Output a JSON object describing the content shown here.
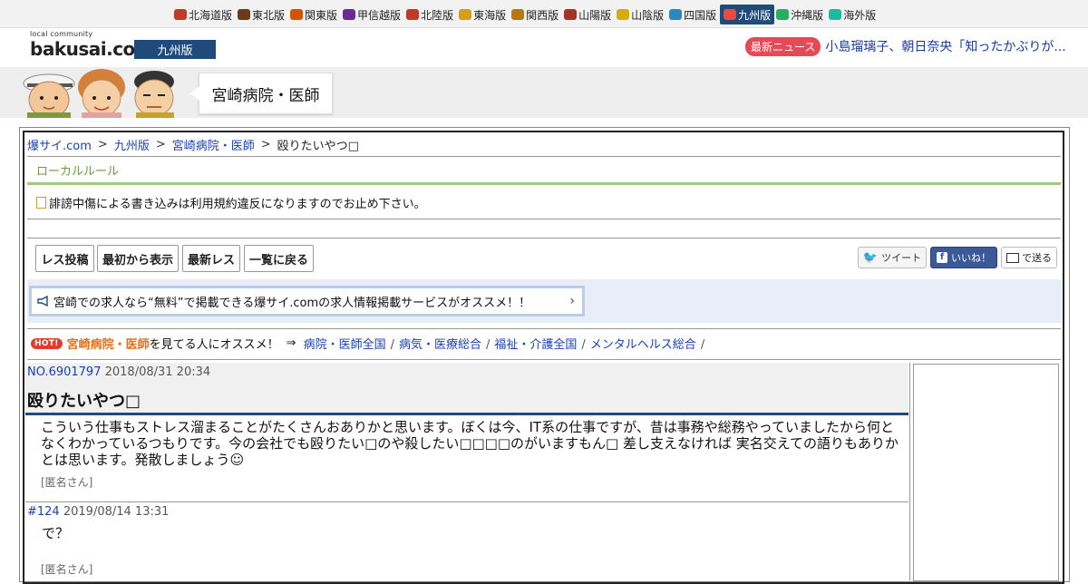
{
  "region_nav": [
    {
      "label": "北海道版",
      "icon": "hokkaido-icon",
      "color": "#c0392b",
      "active": false
    },
    {
      "label": "東北版",
      "icon": "tohoku-icon",
      "color": "#6b3b1a",
      "active": false
    },
    {
      "label": "関東版",
      "icon": "tower-icon",
      "color": "#d35400",
      "active": false
    },
    {
      "label": "甲信越版",
      "icon": "grape-icon",
      "color": "#6a2c91",
      "active": false
    },
    {
      "label": "北陸版",
      "icon": "gate-icon",
      "color": "#c0392b",
      "active": false
    },
    {
      "label": "東海版",
      "icon": "shachihoko-icon",
      "color": "#d4a017",
      "active": false
    },
    {
      "label": "関西版",
      "icon": "takoyaki-icon",
      "color": "#b9770e",
      "active": false
    },
    {
      "label": "山陽版",
      "icon": "shrine-icon",
      "color": "#a93226",
      "active": false
    },
    {
      "label": "山陰版",
      "icon": "moon-icon",
      "color": "#d4ac0d",
      "active": false
    },
    {
      "label": "四国版",
      "icon": "udon-icon",
      "color": "#2e86c1",
      "active": false
    },
    {
      "label": "九州版",
      "icon": "fish-icon",
      "color": "#e74c3c",
      "active": true
    },
    {
      "label": "沖縄版",
      "icon": "shisa-icon",
      "color": "#27ae60",
      "active": false
    },
    {
      "label": "海外版",
      "icon": "globe-icon",
      "color": "#1abc9c",
      "active": false
    }
  ],
  "header": {
    "logo_small": "local community",
    "logo_text": "bakusai.com",
    "edition": "九州版",
    "news_badge": "最新ニュース",
    "news_text": "小島瑠璃子、朝日奈央「知ったかぶりが..."
  },
  "banner": {
    "board_title": "宮崎病院・医師"
  },
  "breadcrumb": [
    {
      "label": "爆サイ.com",
      "link": true
    },
    {
      "label": "九州版",
      "link": true
    },
    {
      "label": "宮崎病院・医師",
      "link": true
    },
    {
      "label": "殴りたいやつ□",
      "link": false
    }
  ],
  "local_rule": {
    "title": "ローカルルール",
    "notice": "誹謗中傷による書き込みは利用規約違反になりますのでお止め下さい。"
  },
  "buttons": {
    "post": "レス投稿",
    "from_start": "最初から表示",
    "latest": "最新レス",
    "back_to_list": "一覧に戻る",
    "tweet": "ツイート",
    "like": "いいね！",
    "send": "で送る"
  },
  "job_banner": {
    "text": "宮崎での求人なら“無料”で掲載できる爆サイ.comの求人情報掲載サービスがオススメ！！"
  },
  "recommend": {
    "hot": "HOT!",
    "board": "宮崎病院・医師",
    "suffix": "を見てる人にオススメ！",
    "arrow": "⇒",
    "links": [
      "病院・医師全国",
      "病気・医療総合",
      "福祉・介護全国",
      "メンタルヘルス総合"
    ]
  },
  "op_post": {
    "number": "NO.6901797",
    "date": "2018/08/31 20:34",
    "title": "殴りたいやつ□",
    "body": "こういう仕事もストレス溜まることがたくさんおありかと思います。ぼくは今、IT系の仕事ですが、昔は事務や総務やっていましたから何となくわかっているつもりです。今の会社でも殴りたい□のや殺したい□□□□のがいますもん□  差し支えなければ  実名交えての語りもありかとは思います。発散しましょう☺",
    "author": "[匿名さん]"
  },
  "reply": {
    "number": "#124",
    "date": "2019/08/14 13:31",
    "body": "で？",
    "author": "[匿名さん]"
  }
}
